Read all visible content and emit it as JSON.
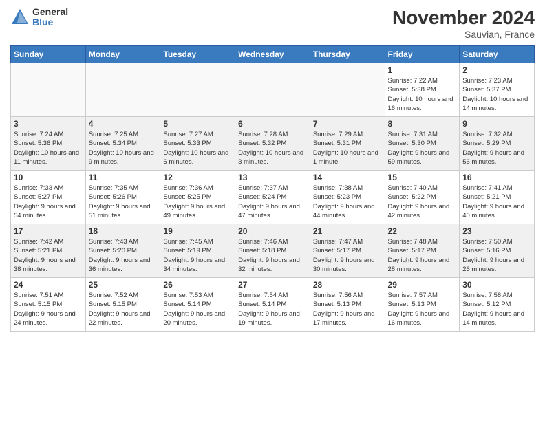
{
  "logo": {
    "general": "General",
    "blue": "Blue"
  },
  "title": "November 2024",
  "location": "Sauvian, France",
  "days_of_week": [
    "Sunday",
    "Monday",
    "Tuesday",
    "Wednesday",
    "Thursday",
    "Friday",
    "Saturday"
  ],
  "cells": [
    {
      "day": "",
      "info": "",
      "empty": true
    },
    {
      "day": "",
      "info": "",
      "empty": true
    },
    {
      "day": "",
      "info": "",
      "empty": true
    },
    {
      "day": "",
      "info": "",
      "empty": true
    },
    {
      "day": "",
      "info": "",
      "empty": true
    },
    {
      "day": "1",
      "info": "Sunrise: 7:22 AM\nSunset: 5:38 PM\nDaylight: 10 hours and 16 minutes."
    },
    {
      "day": "2",
      "info": "Sunrise: 7:23 AM\nSunset: 5:37 PM\nDaylight: 10 hours and 14 minutes."
    },
    {
      "day": "3",
      "info": "Sunrise: 7:24 AM\nSunset: 5:36 PM\nDaylight: 10 hours and 11 minutes."
    },
    {
      "day": "4",
      "info": "Sunrise: 7:25 AM\nSunset: 5:34 PM\nDaylight: 10 hours and 9 minutes."
    },
    {
      "day": "5",
      "info": "Sunrise: 7:27 AM\nSunset: 5:33 PM\nDaylight: 10 hours and 6 minutes."
    },
    {
      "day": "6",
      "info": "Sunrise: 7:28 AM\nSunset: 5:32 PM\nDaylight: 10 hours and 3 minutes."
    },
    {
      "day": "7",
      "info": "Sunrise: 7:29 AM\nSunset: 5:31 PM\nDaylight: 10 hours and 1 minute."
    },
    {
      "day": "8",
      "info": "Sunrise: 7:31 AM\nSunset: 5:30 PM\nDaylight: 9 hours and 59 minutes."
    },
    {
      "day": "9",
      "info": "Sunrise: 7:32 AM\nSunset: 5:29 PM\nDaylight: 9 hours and 56 minutes."
    },
    {
      "day": "10",
      "info": "Sunrise: 7:33 AM\nSunset: 5:27 PM\nDaylight: 9 hours and 54 minutes."
    },
    {
      "day": "11",
      "info": "Sunrise: 7:35 AM\nSunset: 5:26 PM\nDaylight: 9 hours and 51 minutes."
    },
    {
      "day": "12",
      "info": "Sunrise: 7:36 AM\nSunset: 5:25 PM\nDaylight: 9 hours and 49 minutes."
    },
    {
      "day": "13",
      "info": "Sunrise: 7:37 AM\nSunset: 5:24 PM\nDaylight: 9 hours and 47 minutes."
    },
    {
      "day": "14",
      "info": "Sunrise: 7:38 AM\nSunset: 5:23 PM\nDaylight: 9 hours and 44 minutes."
    },
    {
      "day": "15",
      "info": "Sunrise: 7:40 AM\nSunset: 5:22 PM\nDaylight: 9 hours and 42 minutes."
    },
    {
      "day": "16",
      "info": "Sunrise: 7:41 AM\nSunset: 5:21 PM\nDaylight: 9 hours and 40 minutes."
    },
    {
      "day": "17",
      "info": "Sunrise: 7:42 AM\nSunset: 5:21 PM\nDaylight: 9 hours and 38 minutes."
    },
    {
      "day": "18",
      "info": "Sunrise: 7:43 AM\nSunset: 5:20 PM\nDaylight: 9 hours and 36 minutes."
    },
    {
      "day": "19",
      "info": "Sunrise: 7:45 AM\nSunset: 5:19 PM\nDaylight: 9 hours and 34 minutes."
    },
    {
      "day": "20",
      "info": "Sunrise: 7:46 AM\nSunset: 5:18 PM\nDaylight: 9 hours and 32 minutes."
    },
    {
      "day": "21",
      "info": "Sunrise: 7:47 AM\nSunset: 5:17 PM\nDaylight: 9 hours and 30 minutes."
    },
    {
      "day": "22",
      "info": "Sunrise: 7:48 AM\nSunset: 5:17 PM\nDaylight: 9 hours and 28 minutes."
    },
    {
      "day": "23",
      "info": "Sunrise: 7:50 AM\nSunset: 5:16 PM\nDaylight: 9 hours and 26 minutes."
    },
    {
      "day": "24",
      "info": "Sunrise: 7:51 AM\nSunset: 5:15 PM\nDaylight: 9 hours and 24 minutes."
    },
    {
      "day": "25",
      "info": "Sunrise: 7:52 AM\nSunset: 5:15 PM\nDaylight: 9 hours and 22 minutes."
    },
    {
      "day": "26",
      "info": "Sunrise: 7:53 AM\nSunset: 5:14 PM\nDaylight: 9 hours and 20 minutes."
    },
    {
      "day": "27",
      "info": "Sunrise: 7:54 AM\nSunset: 5:14 PM\nDaylight: 9 hours and 19 minutes."
    },
    {
      "day": "28",
      "info": "Sunrise: 7:56 AM\nSunset: 5:13 PM\nDaylight: 9 hours and 17 minutes."
    },
    {
      "day": "29",
      "info": "Sunrise: 7:57 AM\nSunset: 5:13 PM\nDaylight: 9 hours and 16 minutes."
    },
    {
      "day": "30",
      "info": "Sunrise: 7:58 AM\nSunset: 5:12 PM\nDaylight: 9 hours and 14 minutes."
    }
  ]
}
